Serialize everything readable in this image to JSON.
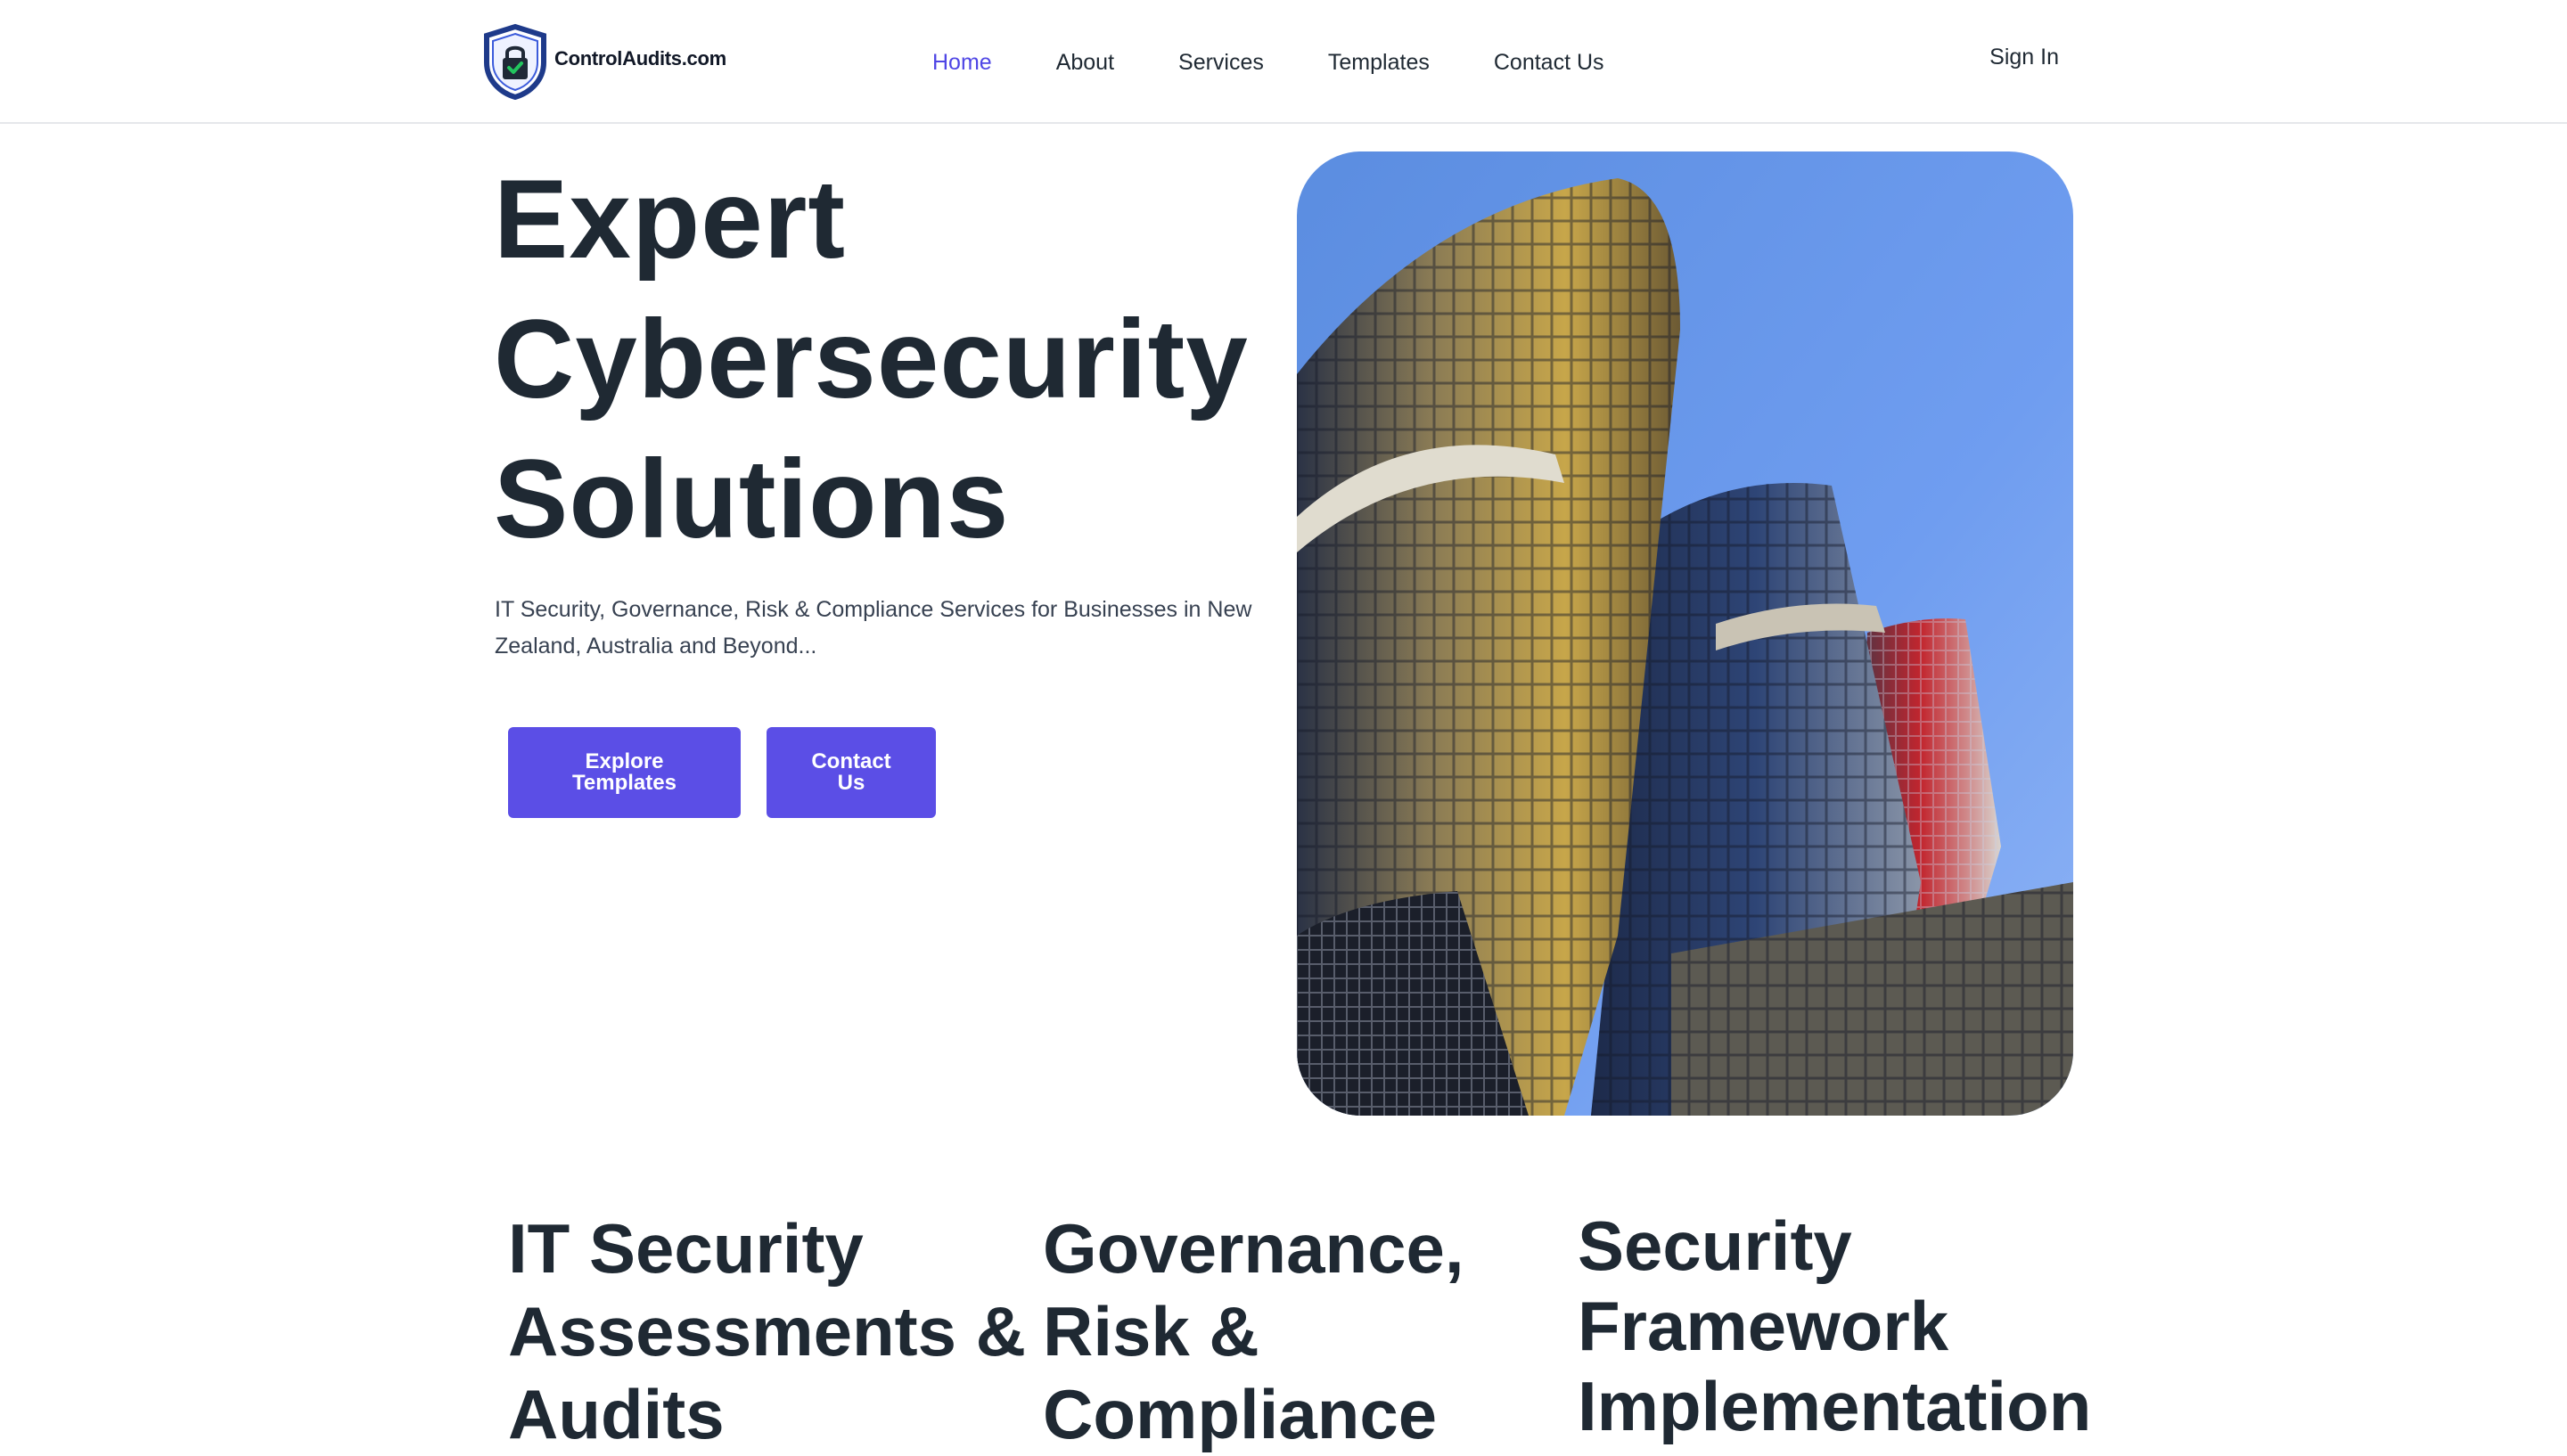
{
  "header": {
    "logo_text": "ControlAudits.com",
    "logo_icon": "shield-lock-icon",
    "nav": [
      {
        "label": "Home",
        "active": true
      },
      {
        "label": "About",
        "active": false
      },
      {
        "label": "Services",
        "active": false
      },
      {
        "label": "Templates",
        "active": false
      },
      {
        "label": "Contact Us",
        "active": false
      }
    ],
    "sign_in": "Sign In"
  },
  "hero": {
    "title_lines": [
      "Expert",
      "Cybersecurity",
      "Solutions"
    ],
    "subtitle": "IT Security, Governance, Risk & Compliance Services for Businesses in New Zealand, Australia and Beyond...",
    "buttons": {
      "explore": [
        "Explore",
        "Templates"
      ],
      "contact": [
        "Contact",
        "Us"
      ]
    },
    "image": "skyscrapers-photo"
  },
  "services": [
    {
      "lines": [
        "IT Security",
        "Assessments &",
        "Audits"
      ]
    },
    {
      "lines": [
        "Governance,",
        "Risk &",
        "Compliance"
      ]
    },
    {
      "lines": [
        "Security",
        "Framework",
        "Implementation"
      ]
    }
  ],
  "colors": {
    "accent": "#4f46e5",
    "button": "#5b4ee6",
    "text": "#1f2933",
    "shield_blue": "#1e40af",
    "lock_green": "#16a34a"
  }
}
